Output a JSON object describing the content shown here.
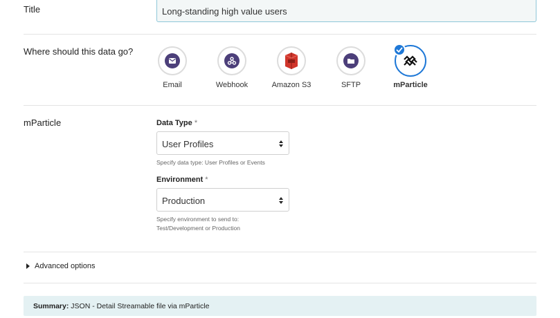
{
  "title_row": {
    "label": "Title",
    "value": "Long-standing high value users"
  },
  "destination_row": {
    "label": "Where should this data go?",
    "options": [
      {
        "label": "Email",
        "icon": "email-icon",
        "color": "#4c3f7a",
        "selected": false
      },
      {
        "label": "Webhook",
        "icon": "webhook-icon",
        "color": "#4c3f7a",
        "selected": false
      },
      {
        "label": "Amazon S3",
        "icon": "amazon-s3-icon",
        "color": "#d0352b",
        "selected": false
      },
      {
        "label": "SFTP",
        "icon": "folder-icon",
        "color": "#4c3f7a",
        "selected": false
      },
      {
        "label": "mParticle",
        "icon": "mparticle-icon",
        "color": "#111111",
        "selected": true
      }
    ],
    "selected_color": "#1e78d7"
  },
  "mparticle_row": {
    "label": "mParticle",
    "data_type": {
      "label": "Data Type",
      "required": "*",
      "value": "User Profiles",
      "help": "Specify data type: User Profiles or Events"
    },
    "environment": {
      "label": "Environment",
      "required": "*",
      "value": "Production",
      "help_line1": "Specify environment to send to:",
      "help_line2": "Test/Development or Production"
    }
  },
  "advanced_options": {
    "label": "Advanced options"
  },
  "summary": {
    "prefix": "Summary:",
    "text": "JSON - Detail Streamable file via mParticle",
    "background": "#e4f1f3"
  }
}
